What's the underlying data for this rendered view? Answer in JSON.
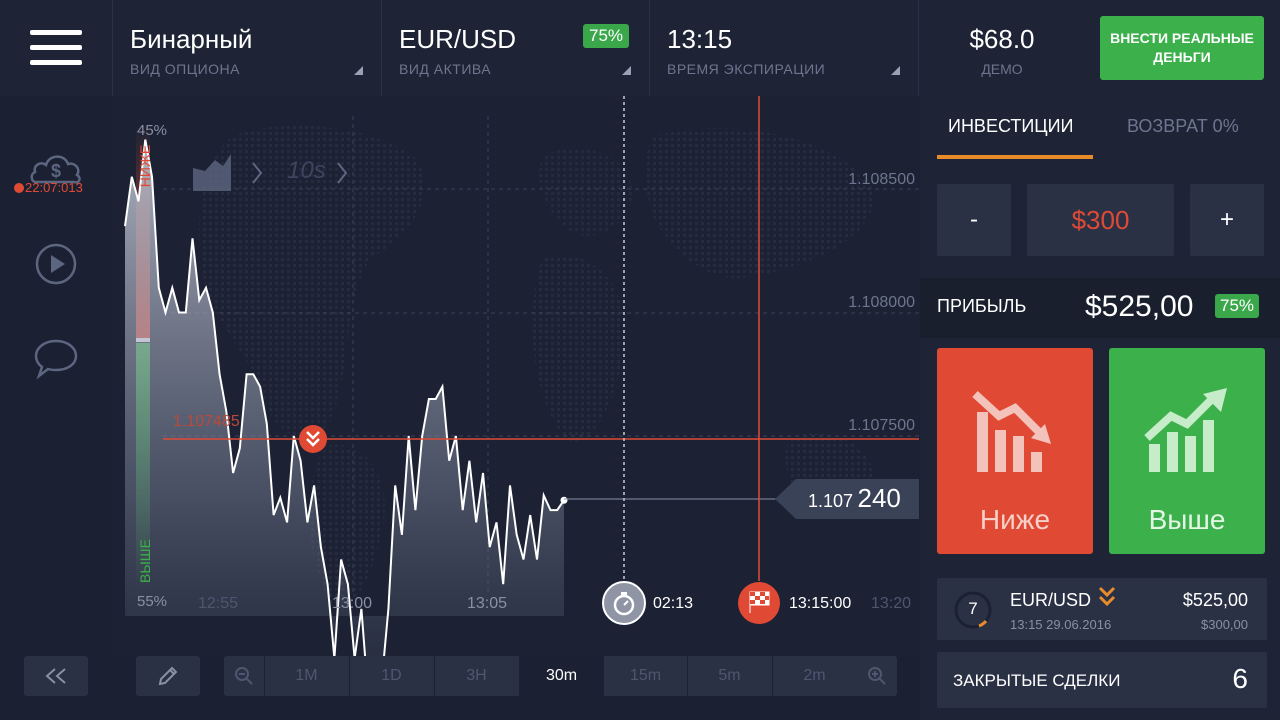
{
  "header": {
    "option_type": {
      "value": "Бинарный",
      "label": "ВИД ОПЦИОНА"
    },
    "asset": {
      "value": "EUR/USD",
      "label": "ВИД АКТИВА",
      "payout": "75%"
    },
    "expiry": {
      "value": "13:15",
      "label": "ВРЕМЯ ЭКСПИРАЦИИ"
    },
    "balance": {
      "value": "$68.0",
      "label": "ДЕМО"
    },
    "deposit_label": "ВНЕСТИ РЕАЛЬНЫЕ ДЕНЬГИ"
  },
  "sidebar": {
    "timer": "22:07:013"
  },
  "chart": {
    "top_pct": "45%",
    "bottom_pct": "55%",
    "down_label": "НИЖЕ",
    "up_label": "ВЫШЕ",
    "interval_label": "10s",
    "price_levels": [
      "1.108500",
      "1.108000",
      "1.107500"
    ],
    "entry_price": "1.107485",
    "current_price_prefix": "1.107",
    "current_price_suffix": "240",
    "time_labels": [
      "12:55",
      "13:00",
      "13:05",
      "13:20"
    ],
    "timer_label": "02:13",
    "expiry_label": "13:15:00"
  },
  "chart_data": {
    "type": "line",
    "title": "",
    "xlabel": "",
    "ylabel": "",
    "x_ticks": [
      "12:55",
      "13:00",
      "13:05",
      "13:20"
    ],
    "y_ticks": [
      1.1085,
      1.108,
      1.1075
    ],
    "series": [
      {
        "values": [
          1.10835,
          1.10855,
          1.10845,
          1.1087,
          1.10855,
          1.1081,
          1.108,
          1.1081,
          1.108,
          1.108,
          1.1083,
          1.10805,
          1.1081,
          1.108,
          1.10775,
          1.1076,
          1.10735,
          1.10745,
          1.10775,
          1.10775,
          1.1077,
          1.10755,
          1.10718,
          1.10725,
          1.10715,
          1.1075,
          1.1074,
          1.10715,
          1.1073,
          1.10705,
          1.1069,
          1.1066,
          1.107,
          1.1069,
          1.1066,
          1.1068,
          1.10645,
          1.1063,
          1.1065,
          1.1068,
          1.1073,
          1.1071,
          1.1075,
          1.1072,
          1.1075,
          1.10765,
          1.10765,
          1.1077,
          1.1074,
          1.1075,
          1.1072,
          1.1074,
          1.10715,
          1.10735,
          1.10705,
          1.10715,
          1.1069,
          1.1073,
          1.1071,
          1.107,
          1.10718,
          1.107,
          1.10726,
          1.1072,
          1.1072,
          1.10724
        ]
      }
    ]
  },
  "timeframes": {
    "items": [
      "1M",
      "1D",
      "3H",
      "30m",
      "15m",
      "5m",
      "2m"
    ],
    "active": "30m"
  },
  "panel": {
    "tab_invest": "ИНВЕСТИЦИИ",
    "tab_refund": "ВОЗВРАТ 0%",
    "minus": "-",
    "amount": "$300",
    "plus": "+",
    "profit_label": "ПРИБЫЛЬ",
    "profit_value": "$525,00",
    "profit_pct": "75%",
    "down_button": "Ниже",
    "up_button": "Выше"
  },
  "trade": {
    "count": "7",
    "asset": "EUR/USD",
    "datetime": "13:15 29.06.2016",
    "profit": "$525,00",
    "amount": "$300,00"
  },
  "closed_trades": {
    "label": "ЗАКРЫТЫЕ СДЕЛКИ",
    "count": "6"
  },
  "colors": {
    "down": "#e04a35",
    "up": "#3bb04b",
    "accent": "#e88b2b",
    "background": "#1b2132"
  }
}
